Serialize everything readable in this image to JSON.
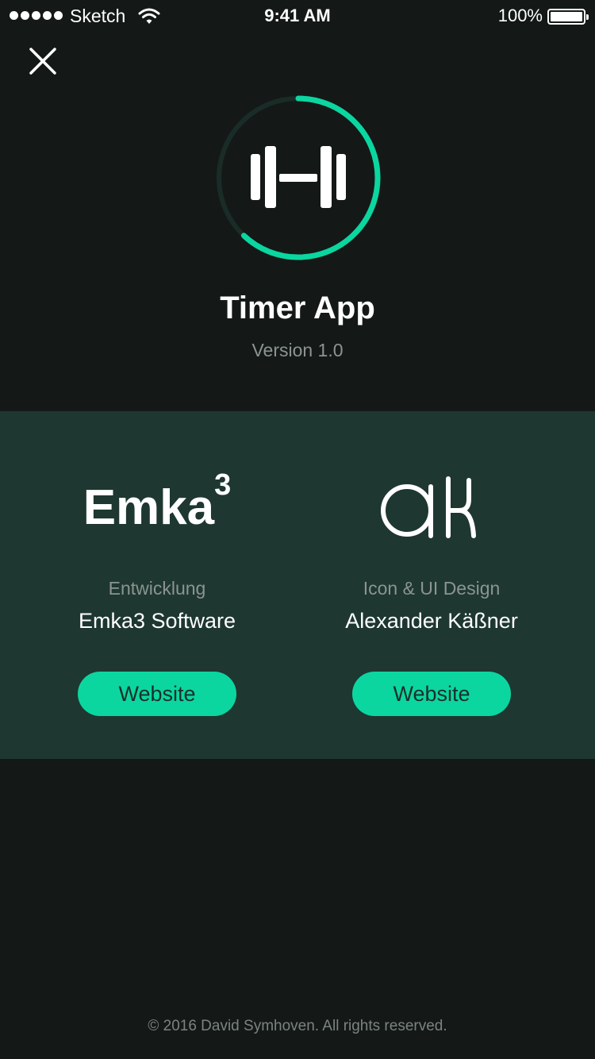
{
  "status_bar": {
    "carrier": "Sketch",
    "time": "9:41 AM",
    "battery_percent": "100%",
    "signal_bars": 5
  },
  "header": {
    "close_icon": "close-icon"
  },
  "app": {
    "icon": "dumbbell-icon",
    "progress": 0.62,
    "title": "Timer App",
    "version": "Version 1.0"
  },
  "credits": [
    {
      "logo": "Emka",
      "logo_superscript": "3",
      "role": "Entwicklung",
      "name": "Emka3 Software",
      "button_label": "Website"
    },
    {
      "logo": "aK",
      "role": "Icon & UI Design",
      "name": "Alexander Käßner",
      "button_label": "Website"
    }
  ],
  "footer": {
    "copyright": "© 2016 David Symhoven. All rights reserved."
  },
  "colors": {
    "background": "#141917",
    "credits_background": "#1e3731",
    "accent": "#0bd6a0",
    "muted_text": "#8c9490"
  }
}
